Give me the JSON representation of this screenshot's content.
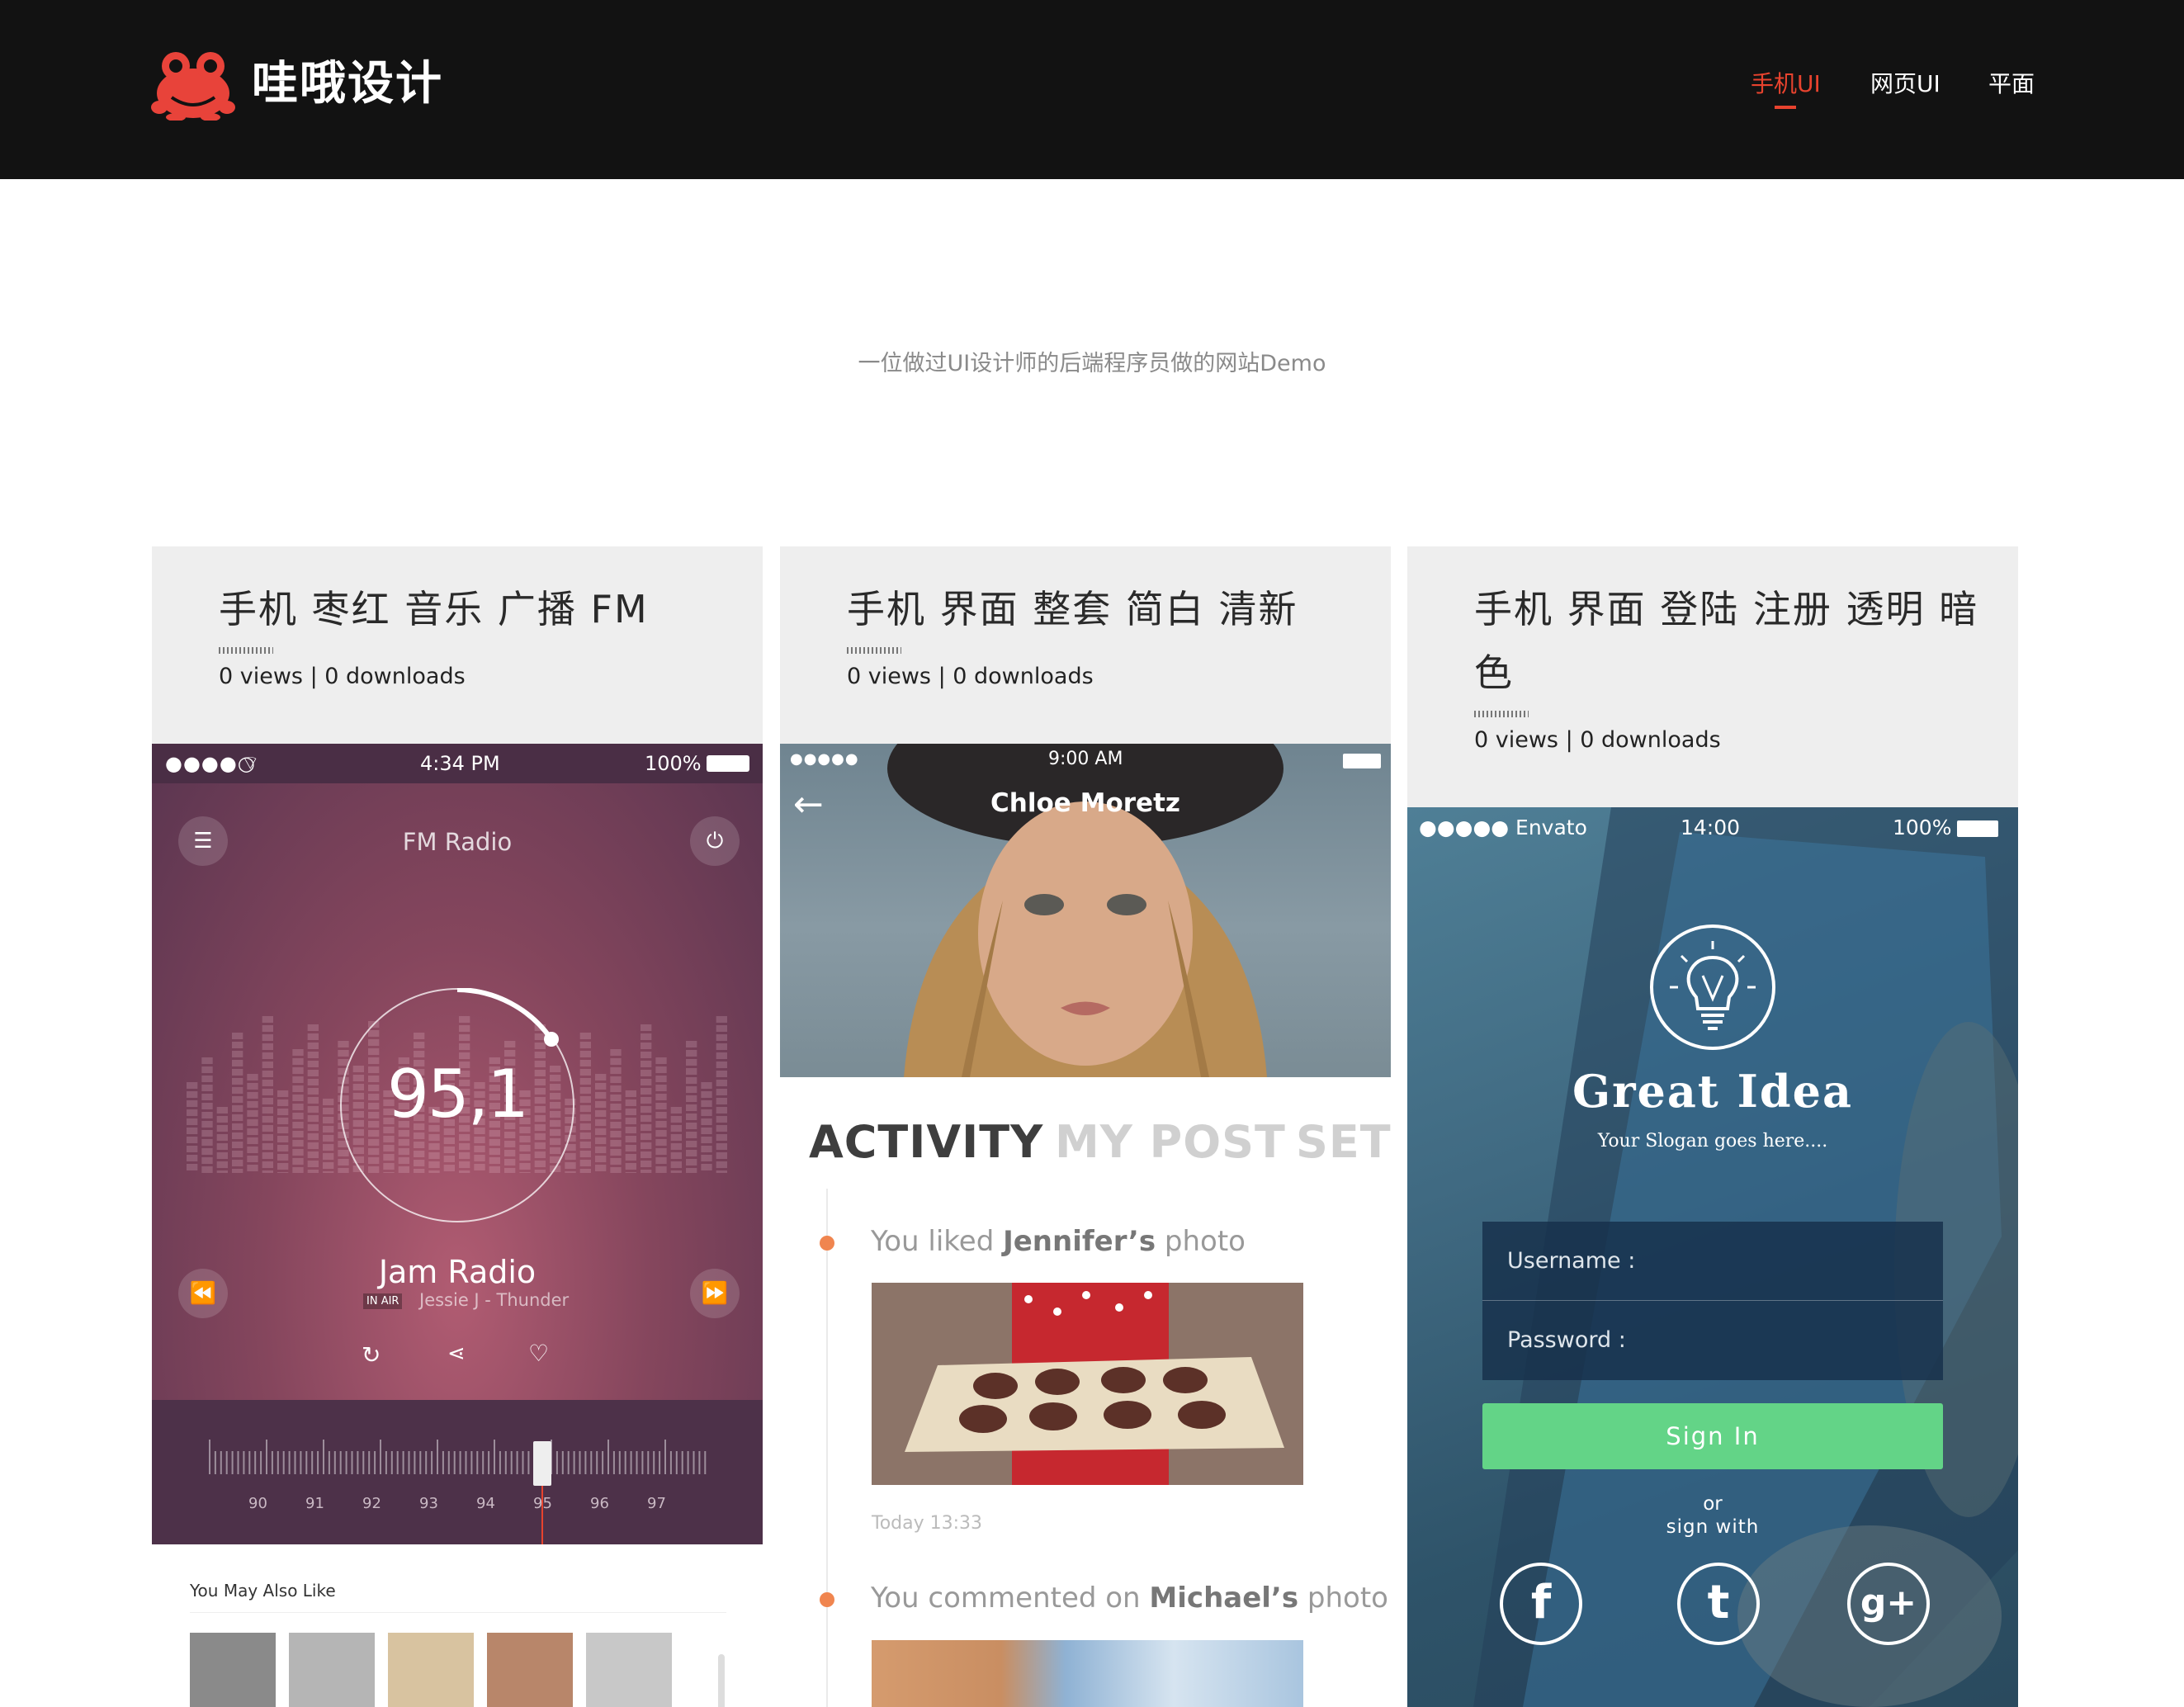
{
  "header": {
    "brand": "哇哦设计",
    "nav": [
      {
        "label": "手机UI",
        "active": true
      },
      {
        "label": "网页UI",
        "active": false
      },
      {
        "label": "平面",
        "active": false
      }
    ],
    "accent_color": "#e8432e"
  },
  "subtitle": "一位做过UI设计师的后端程序员做的网站Demo",
  "cards": [
    {
      "title": "手机 枣红 音乐 广播 FM",
      "stats": "0 views | 0 downloads",
      "preview": {
        "status_time": "4:34 PM",
        "status_battery": "100%",
        "screen_title": "FM Radio",
        "frequency": "95,1",
        "station": "Jam Radio",
        "onair_badge": "IN AIR",
        "track": "Jessie J - Thunder",
        "ticks": [
          "90",
          "91",
          "92",
          "93",
          "94",
          "95",
          "96",
          "97"
        ],
        "below_label": "You May Also Like"
      }
    },
    {
      "title": "手机 界面 整套 简白 清新",
      "stats": "0 views | 0 downloads",
      "preview": {
        "status_time": "9:00 AM",
        "profile_name": "Chloe Moretz",
        "tabs": [
          "ACTIVITY",
          "MY POST",
          "SETT"
        ],
        "feed": [
          {
            "pre": "You liked ",
            "name": "Jennifer’s",
            "post": " photo",
            "time": "Today 13:33"
          },
          {
            "pre": "You commented on ",
            "name": "Michael’s",
            "post": " photo"
          }
        ]
      }
    },
    {
      "title": "手机 界面 登陆 注册 透明 暗色",
      "stats": "0 views | 0 downloads",
      "preview": {
        "carrier": "●●●●● Envato",
        "status_time": "14:00",
        "status_battery": "100%",
        "app_name": "Great Idea",
        "slogan": "Your Slogan goes here....",
        "username_label": "Username :",
        "password_label": "Password :",
        "signin_label": "Sign In",
        "or_label": "or",
        "signwith_label": "sign with",
        "signin_color": "#63d487"
      }
    }
  ]
}
